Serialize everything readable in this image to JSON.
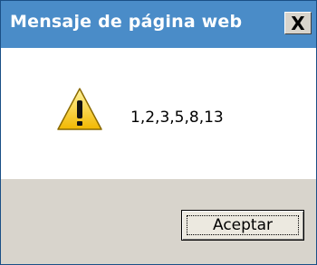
{
  "window": {
    "title": "Mensaje de página web",
    "close_glyph": "X"
  },
  "dialog": {
    "icon": "warning-icon",
    "message": "1,2,3,5,8,13",
    "ok_label": "Aceptar"
  },
  "colors": {
    "titlebar": "#4a8cc8",
    "footer": "#d8d4cc",
    "warning_yellow": "#f7d23a"
  }
}
